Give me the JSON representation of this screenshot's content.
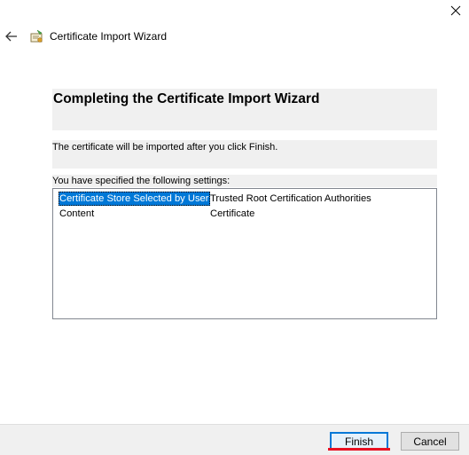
{
  "window": {
    "title": "Certificate Import Wizard",
    "close_icon": "close-icon",
    "back_icon": "back-arrow-icon",
    "app_icon": "certificate-icon"
  },
  "main": {
    "heading": "Completing the Certificate Import Wizard",
    "info_text": "The certificate will be imported after you click Finish.",
    "settings_label": "You have specified the following settings:",
    "settings": [
      {
        "key": "Certificate Store Selected by User",
        "value": "Trusted Root Certification Authorities"
      },
      {
        "key": "Content",
        "value": "Certificate"
      }
    ]
  },
  "buttons": {
    "finish_label": "Finish",
    "cancel_label": "Cancel"
  },
  "colors": {
    "selection": "#0078d7",
    "band": "#f0f0f0",
    "finish_underline": "#e81123"
  }
}
